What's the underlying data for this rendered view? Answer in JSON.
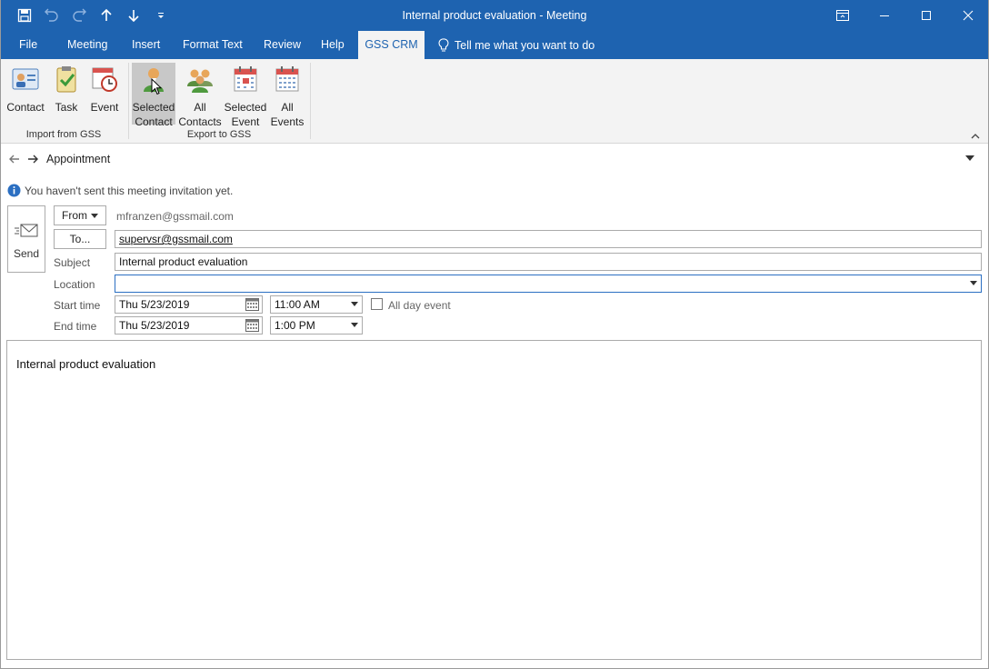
{
  "window": {
    "title": "Internal product evaluation  -  Meeting"
  },
  "tabs": [
    {
      "label": "File"
    },
    {
      "label": "Meeting"
    },
    {
      "label": "Insert"
    },
    {
      "label": "Format Text"
    },
    {
      "label": "Review"
    },
    {
      "label": "Help"
    },
    {
      "label": "GSS CRM"
    }
  ],
  "tell_me": "Tell me what you want to do",
  "ribbon": {
    "import_group": {
      "label": "Import from GSS",
      "buttons": [
        {
          "line1": "Contact",
          "line2": ""
        },
        {
          "line1": "Task",
          "line2": ""
        },
        {
          "line1": "Event",
          "line2": ""
        }
      ]
    },
    "export_group": {
      "label": "Export to GSS",
      "buttons": [
        {
          "line1": "Selected",
          "line2": "Contact"
        },
        {
          "line1": "All",
          "line2": "Contacts"
        },
        {
          "line1": "Selected",
          "line2": "Event"
        },
        {
          "line1": "All",
          "line2": "Events"
        }
      ]
    }
  },
  "appointment": {
    "label": "Appointment"
  },
  "info": "You haven't sent this meeting invitation yet.",
  "form": {
    "send_label": "Send",
    "from_label": "From",
    "from_value": "mfranzen@gssmail.com",
    "to_label": "To...",
    "to_value": "supervsr@gssmail.com",
    "subject_label": "Subject",
    "subject_value": "Internal product evaluation",
    "location_label": "Location",
    "location_value": "",
    "start_label": "Start time",
    "start_date": "Thu 5/23/2019",
    "start_time": "11:00 AM",
    "end_label": "End time",
    "end_date": "Thu 5/23/2019",
    "end_time": "1:00 PM",
    "all_day_label": "All day event"
  },
  "body_text": "Internal product evaluation",
  "colors": {
    "accent": "#1e63b0",
    "ribbon_bg": "#f3f3f3"
  }
}
